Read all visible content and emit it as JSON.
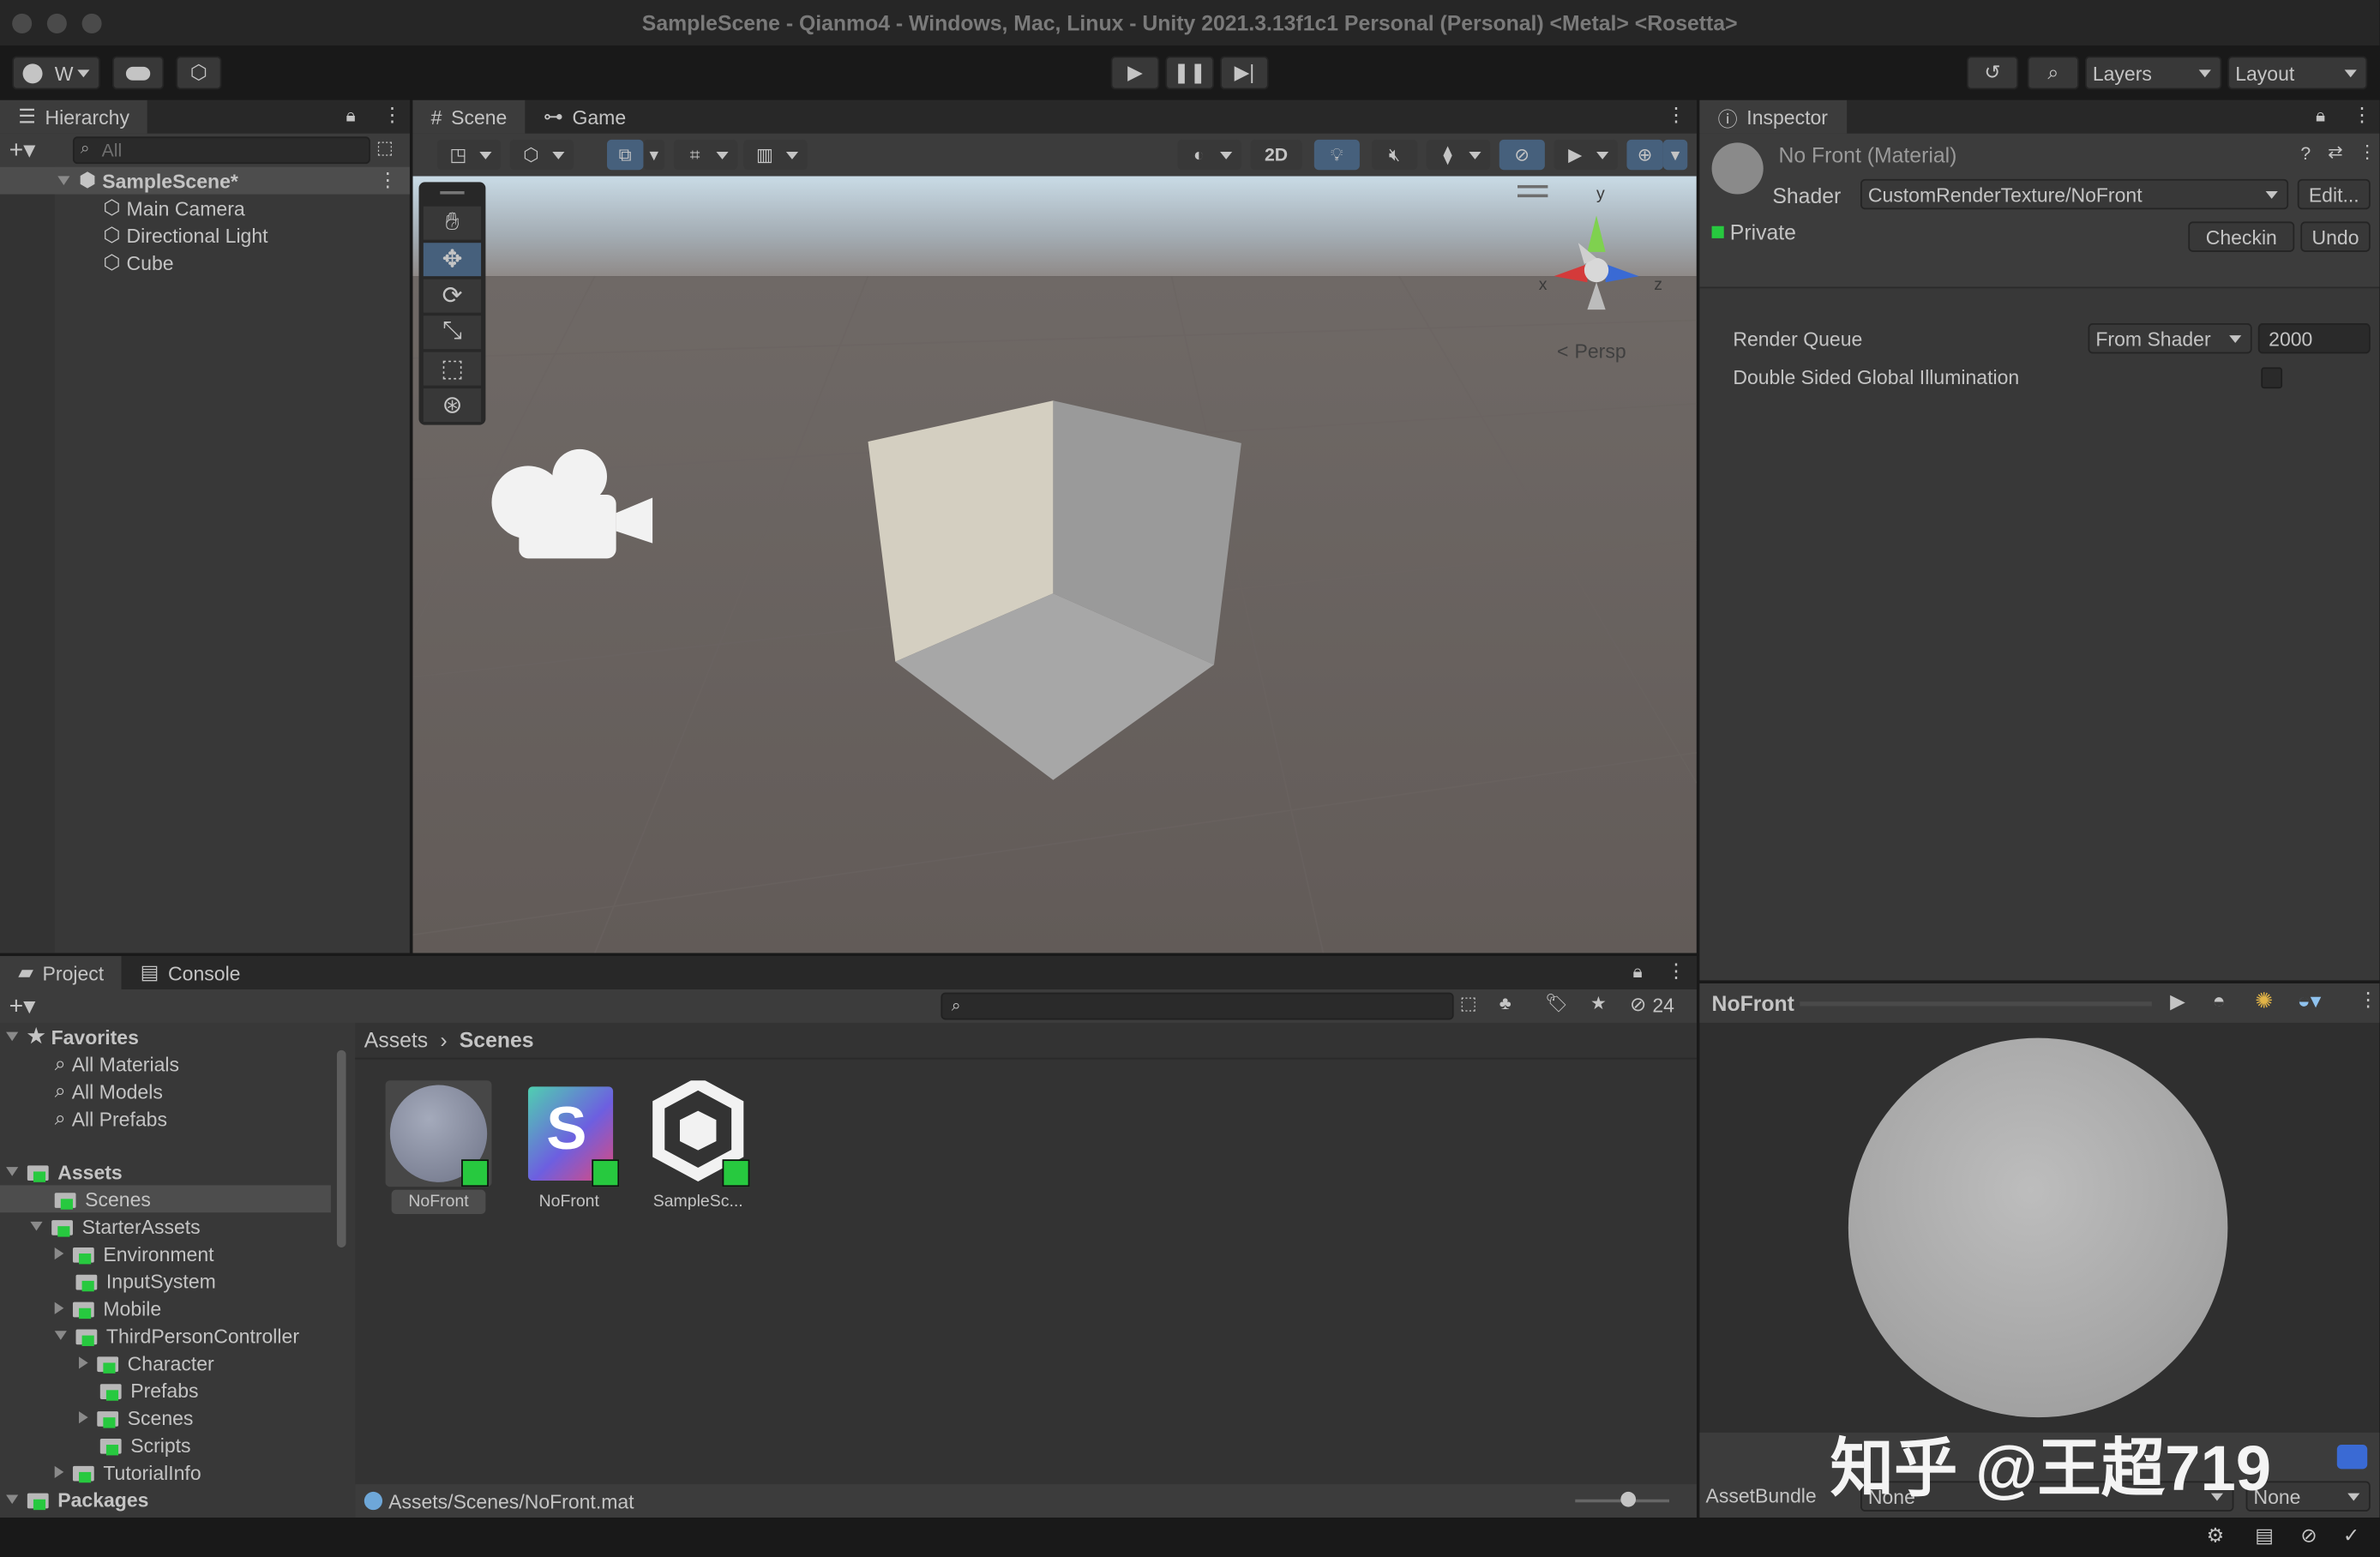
{
  "window": {
    "title": "SampleScene - Qianmo4 - Windows, Mac, Linux - Unity 2021.3.13f1c1 Personal (Personal) <Metal> <Rosetta>"
  },
  "toolbar": {
    "account_label": "W",
    "layers_label": "Layers",
    "layout_label": "Layout"
  },
  "hierarchy": {
    "tab_label": "Hierarchy",
    "search_placeholder": "All",
    "scene_name": "SampleScene*",
    "items": [
      {
        "label": "Main Camera"
      },
      {
        "label": "Directional Light"
      },
      {
        "label": "Cube"
      }
    ]
  },
  "scene": {
    "tabs": [
      {
        "label": "Scene"
      },
      {
        "label": "Game"
      }
    ],
    "mode_2d": "2D",
    "persp_label": "Persp",
    "gizmo": {
      "x": "x",
      "y": "y",
      "z": "z"
    }
  },
  "inspector": {
    "tab_label": "Inspector",
    "material_title": "No Front (Material)",
    "shader_label": "Shader",
    "shader_value": "CustomRenderTexture/NoFront",
    "edit_button": "Edit...",
    "private_label": "Private",
    "checkin_button": "Checkin",
    "undo_button": "Undo",
    "render_queue_label": "Render Queue",
    "render_queue_mode": "From Shader",
    "render_queue_value": "2000",
    "dsgi_label": "Double Sided Global Illumination"
  },
  "project": {
    "tabs": [
      {
        "label": "Project"
      },
      {
        "label": "Console"
      }
    ],
    "hidden_count": "24",
    "favorites": {
      "label": "Favorites",
      "items": [
        {
          "label": "All Materials"
        },
        {
          "label": "All Models"
        },
        {
          "label": "All Prefabs"
        }
      ]
    },
    "assets_label": "Assets",
    "tree": [
      {
        "label": "Scenes"
      },
      {
        "label": "StarterAssets"
      },
      {
        "label": "Environment"
      },
      {
        "label": "InputSystem"
      },
      {
        "label": "Mobile"
      },
      {
        "label": "ThirdPersonController"
      },
      {
        "label": "Character"
      },
      {
        "label": "Prefabs"
      },
      {
        "label": "Scenes"
      },
      {
        "label": "Scripts"
      },
      {
        "label": "TutorialInfo"
      }
    ],
    "packages_label": "Packages",
    "breadcrumb": {
      "root": "Assets",
      "current": "Scenes"
    },
    "assets": [
      {
        "label": "NoFront"
      },
      {
        "label": "NoFront"
      },
      {
        "label": "SampleSc..."
      }
    ],
    "footer_path": "Assets/Scenes/NoFront.mat"
  },
  "preview": {
    "title": "NoFront",
    "assetbundle_label": "AssetBundle",
    "bundle_value": "None",
    "variant_value": "None"
  },
  "watermark": "知乎 @王超719",
  "colors": {
    "accent": "#46607c",
    "selection": "#4d4d4d",
    "check_green": "#27c93f"
  }
}
